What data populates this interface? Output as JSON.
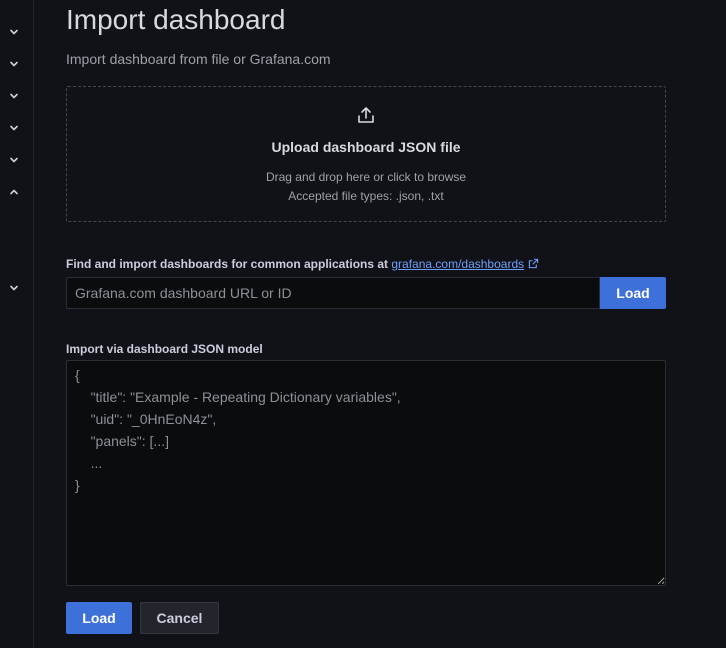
{
  "sidebar": {
    "toggles": [
      {
        "icon": "chevron-down-icon"
      },
      {
        "icon": "chevron-down-icon"
      },
      {
        "icon": "chevron-down-icon"
      },
      {
        "icon": "chevron-down-icon"
      },
      {
        "icon": "chevron-down-icon"
      },
      {
        "icon": "chevron-up-icon"
      },
      {
        "icon": "chevron-down-icon"
      }
    ]
  },
  "page": {
    "title": "Import dashboard",
    "subtitle": "Import dashboard from file or Grafana.com"
  },
  "upload": {
    "icon": "upload-icon",
    "title": "Upload dashboard JSON file",
    "hint_line1": "Drag and drop here or click to browse",
    "hint_line2": "Accepted file types: .json, .txt"
  },
  "grafana_com": {
    "label": "Find and import dashboards for common applications at",
    "link_text": "grafana.com/dashboards",
    "link_icon": "external-link-icon",
    "input_placeholder": "Grafana.com dashboard URL or ID",
    "input_value": "",
    "load_label": "Load"
  },
  "json_model": {
    "label": "Import via dashboard JSON model",
    "placeholder": "{\n    \"title\": \"Example - Repeating Dictionary variables\",\n    \"uid\": \"_0HnEoN4z\",\n    \"panels\": [...]\n    ...\n}",
    "value": ""
  },
  "actions": {
    "load_label": "Load",
    "cancel_label": "Cancel"
  },
  "colors": {
    "background": "#111217",
    "primary": "#3d71d9",
    "link": "#6e9fff"
  }
}
